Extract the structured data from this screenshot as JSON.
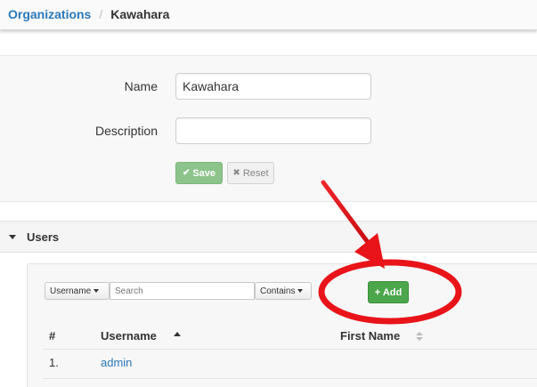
{
  "breadcrumb": {
    "parent": "Organizations",
    "separator": "/",
    "current": "Kawahara"
  },
  "form": {
    "name_label": "Name",
    "name_value": "Kawahara",
    "description_label": "Description",
    "description_value": "",
    "save_label": "Save",
    "reset_label": "Reset"
  },
  "users": {
    "section_title": "Users",
    "filter_field": "Username",
    "search_placeholder": "Search",
    "match_mode": "Contains",
    "add_label": "+ Add",
    "columns": [
      "#",
      "Username",
      "First Name"
    ],
    "rows": [
      {
        "num": "1.",
        "username": "admin"
      }
    ]
  },
  "colors": {
    "link": "#2a78b9",
    "save_button": "#8dc48c",
    "add_button": "#4ca64c",
    "annotation": "#e8141a"
  },
  "icons": {
    "save": "check-icon",
    "reset": "x-icon",
    "section_toggle": "caret-down-icon",
    "annotation": "red-arrow-and-circle"
  }
}
